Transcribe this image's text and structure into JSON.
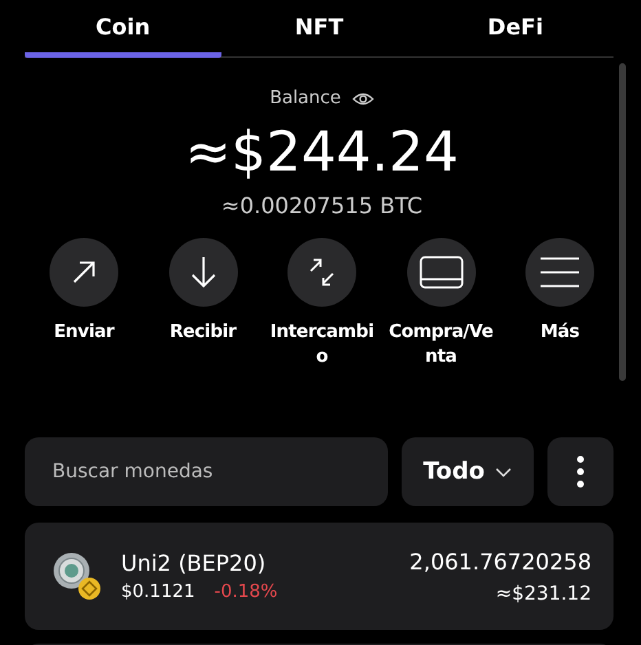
{
  "tabs": [
    {
      "label": "Coin",
      "selected": true
    },
    {
      "label": "NFT",
      "selected": false
    },
    {
      "label": "DeFi",
      "selected": false
    }
  ],
  "balance": {
    "label": "Balance",
    "amount": "≈$244.24",
    "btc": "≈0.00207515 BTC"
  },
  "actions": [
    {
      "kind": "send",
      "label": "Enviar"
    },
    {
      "kind": "receive",
      "label": "Recibir"
    },
    {
      "kind": "swap",
      "label": "Intercambio"
    },
    {
      "kind": "trade",
      "label": "Compra/Venta"
    },
    {
      "kind": "more",
      "label": "Más"
    }
  ],
  "search": {
    "placeholder": "Buscar monedas"
  },
  "filter": {
    "label": "Todo"
  },
  "coins": [
    {
      "name": "Uni2 (BEP20)",
      "price": "$0.1121",
      "change": "-0.18%",
      "color": "#e5484d",
      "amount": "2,061.76720258",
      "value": "≈$231.12"
    }
  ]
}
